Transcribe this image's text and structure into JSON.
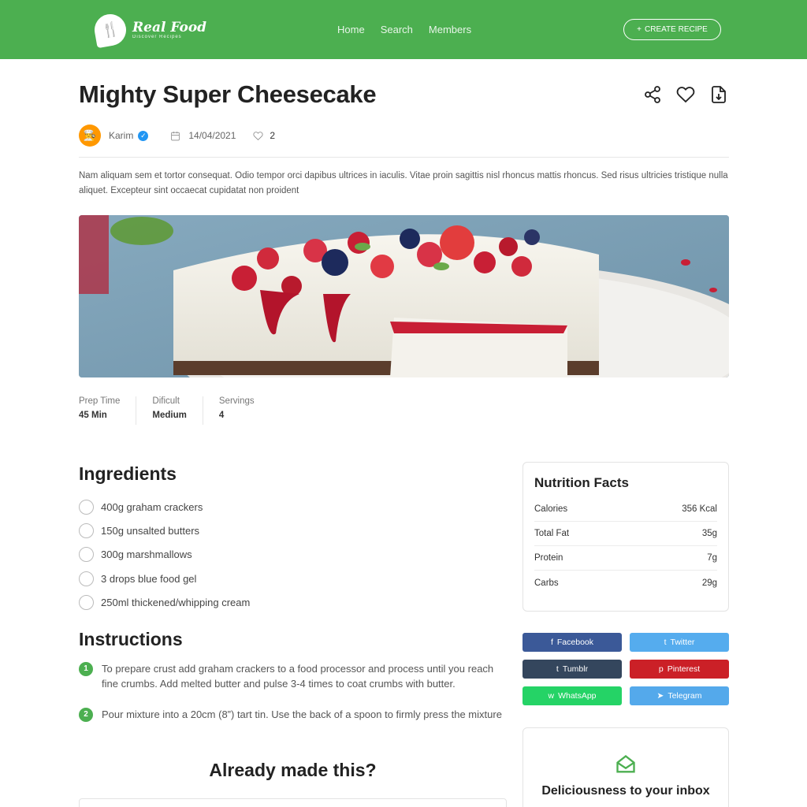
{
  "header": {
    "logo_title": "Real Food",
    "logo_subtitle": "Discover Recipes",
    "nav": [
      "Home",
      "Search",
      "Members"
    ],
    "create_label": "CREATE RECIPE",
    "create_prefix": "+"
  },
  "recipe": {
    "title": "Mighty Super Cheesecake",
    "author": "Karim",
    "date": "14/04/2021",
    "likes": "2",
    "description": "Nam aliquam sem et tortor consequat. Odio tempor orci dapibus ultrices in iaculis. Vitae proin sagittis nisl rhoncus mattis rhoncus. Sed risus ultricies tristique nulla aliquet. Excepteur sint occaecat cupidatat non proident",
    "stats": [
      {
        "label": "Prep Time",
        "value": "45 Min"
      },
      {
        "label": "Dificult",
        "value": "Medium"
      },
      {
        "label": "Servings",
        "value": "4"
      }
    ]
  },
  "ingredients": {
    "heading": "Ingredients",
    "items": [
      "400g graham crackers",
      "150g unsalted butters",
      "300g marshmallows",
      "3 drops blue food gel",
      "250ml thickened/whipping cream"
    ]
  },
  "instructions": {
    "heading": "Instructions",
    "steps": [
      {
        "num": "1",
        "text": "To prepare crust add graham crackers to a food processor and process until you reach fine crumbs. Add melted butter and pulse 3-4 times to coat crumbs with butter."
      },
      {
        "num": "2",
        "text": "Pour mixture into a 20cm (8”) tart tin. Use the back of a spoon to firmly press the mixture"
      }
    ]
  },
  "made": {
    "heading": "Already made this?"
  },
  "nutrition": {
    "title": "Nutrition Facts",
    "rows": [
      {
        "label": "Calories",
        "value": "356 Kcal"
      },
      {
        "label": "Total Fat",
        "value": "35g"
      },
      {
        "label": "Protein",
        "value": "7g"
      },
      {
        "label": "Carbs",
        "value": "29g"
      }
    ]
  },
  "social": [
    {
      "label": "Facebook",
      "icon": "f",
      "color": "#3b5998"
    },
    {
      "label": "Twitter",
      "icon": "t",
      "color": "#55acee"
    },
    {
      "label": "Tumblr",
      "icon": "t",
      "color": "#34465d"
    },
    {
      "label": "Pinterest",
      "icon": "p",
      "color": "#cb2027"
    },
    {
      "label": "WhatsApp",
      "icon": "w",
      "color": "#25d366"
    },
    {
      "label": "Telegram",
      "icon": "➤",
      "color": "#54a9eb"
    }
  ],
  "newsletter": {
    "title": "Deliciousness to your inbox"
  },
  "colors": {
    "brand": "#4caf50"
  }
}
